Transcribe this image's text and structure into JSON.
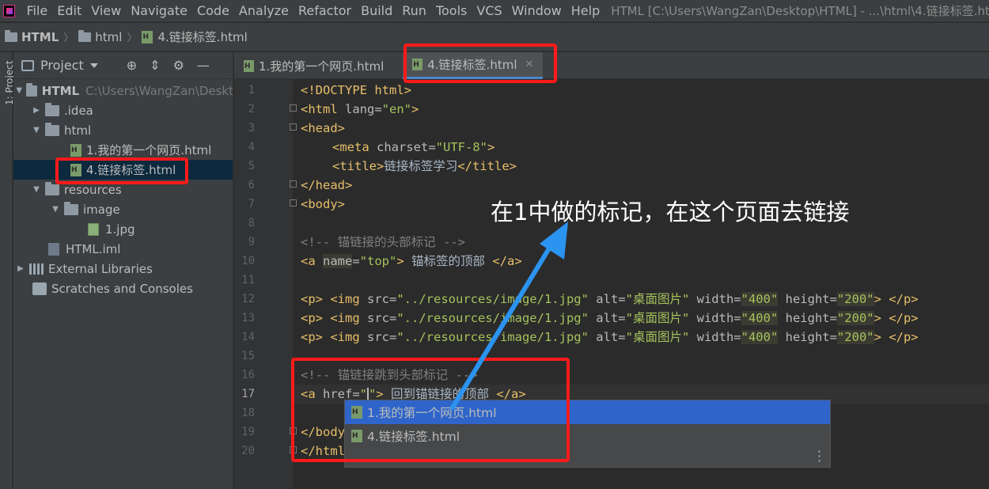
{
  "menubar": {
    "items": [
      "File",
      "Edit",
      "View",
      "Navigate",
      "Code",
      "Analyze",
      "Refactor",
      "Build",
      "Run",
      "Tools",
      "VCS",
      "Window",
      "Help"
    ],
    "window_title": "HTML [C:\\Users\\WangZan\\Desktop\\HTML] - ...\\html\\4.链接标签.html"
  },
  "breadcrumb": [
    "HTML",
    "html",
    "4.链接标签.html"
  ],
  "left_stripe_label": "1: Project",
  "project_panel": {
    "title": "Project",
    "tree": [
      {
        "label": "HTML",
        "path": "C:\\Users\\WangZan\\Deskt",
        "icon": "folder-icon",
        "level": 0,
        "expanded": true
      },
      {
        "label": ".idea",
        "icon": "folder-icon",
        "level": 1,
        "expanded": false
      },
      {
        "label": "html",
        "icon": "folder-icon",
        "level": 1,
        "expanded": true
      },
      {
        "label": "1.我的第一个网页.html",
        "icon": "html-file-icon",
        "level": 2
      },
      {
        "label": "4.链接标签.html",
        "icon": "html-file-icon",
        "level": 2,
        "selected": true
      },
      {
        "label": "resources",
        "icon": "folder-icon",
        "level": 1,
        "expanded": true
      },
      {
        "label": "image",
        "icon": "folder-icon",
        "level": 2,
        "expanded": true
      },
      {
        "label": "1.jpg",
        "icon": "image-file-icon",
        "level": 3
      },
      {
        "label": "HTML.iml",
        "icon": "iml-file-icon",
        "level": 1
      },
      {
        "label": "External Libraries",
        "icon": "library-icon",
        "level": 0,
        "expanded": false
      },
      {
        "label": "Scratches and Consoles",
        "icon": "scratches-icon",
        "level": 0
      }
    ]
  },
  "tabs": [
    {
      "label": "1.我的第一个网页.html",
      "active": false
    },
    {
      "label": "4.链接标签.html",
      "active": true
    }
  ],
  "code": {
    "line_numbers": [
      "1",
      "2",
      "3",
      "4",
      "5",
      "6",
      "7",
      "8",
      "9",
      "10",
      "11",
      "12",
      "13",
      "14",
      "15",
      "16",
      "17",
      "18",
      "19",
      "20"
    ],
    "l1": "<!DOCTYPE html>",
    "l2_tag": "<html ",
    "l2_attr": "lang=",
    "l2_val": "\"en\"",
    "l2_end": ">",
    "l3": "<head>",
    "l4_tag": "<meta ",
    "l4_attr": "charset=",
    "l4_val": "\"UTF-8\"",
    "l4_end": ">",
    "l5_open": "<title>",
    "l5_text": "链接标签学习",
    "l5_close": "</title>",
    "l6": "</head>",
    "l7": "<body>",
    "l9": "<!-- 锚链接的头部标记 -->",
    "l10_tag": "<a ",
    "l10_attr": "name",
    "l10_eq": "=",
    "l10_val": "\"top\"",
    "l10_end": ">",
    "l10_text": " 锚标签的顶部 ",
    "l10_close": "</a>",
    "img_p_open": "<p> ",
    "img_tag": "<img ",
    "img_src_attr": "src=",
    "img_src_val": "\"../resources/image/1.jpg\"",
    "img_alt_attr": " alt=",
    "img_alt_val": "\"桌面图片\"",
    "img_w_attr": " width=",
    "img_w_val": "\"400\"",
    "img_h_attr": " height=",
    "img_h_val": "\"200\"",
    "img_end": "> ",
    "img_p_close": "</p>",
    "l16": "<!-- 锚链接跳到头部标记 -->",
    "l17_tag": "<a ",
    "l17_attr": "href=",
    "l17_val_open": "\"",
    "l17_val_close": "\"",
    "l17_end": ">",
    "l17_text": " 回到锚链接的顶部 ",
    "l17_close": "</a>",
    "l19": "</body>",
    "l20": "</html>"
  },
  "completion": {
    "items": [
      "1.我的第一个网页.html",
      "4.链接标签.html"
    ]
  },
  "annotation": {
    "text": "在1中做的标记，在这个页面去链接"
  },
  "colors": {
    "annotation_box": "#ff1a1a",
    "arrow": "#2b93f0"
  }
}
